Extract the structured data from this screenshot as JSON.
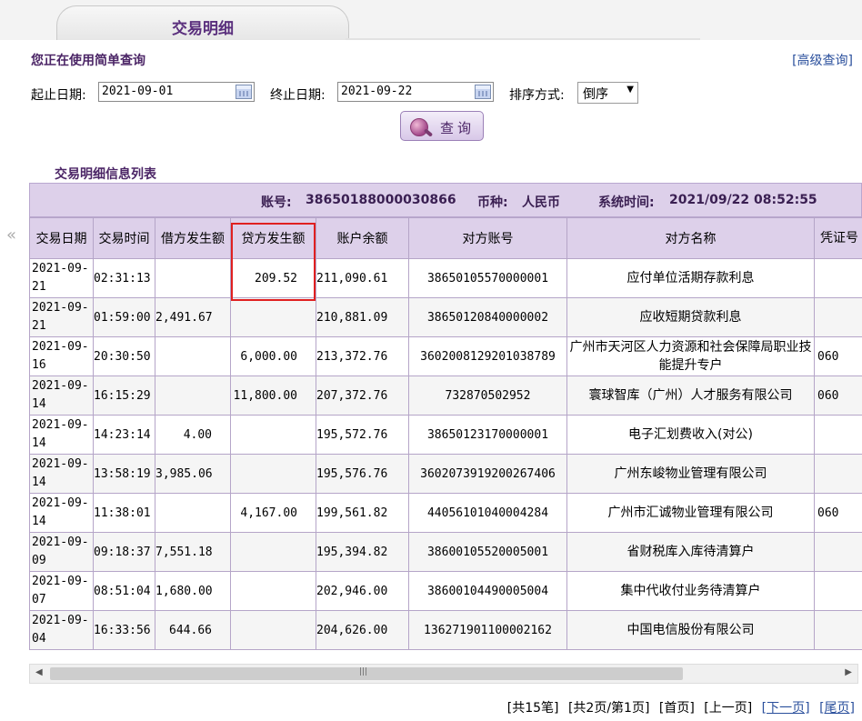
{
  "tab": {
    "title": "交易明细"
  },
  "query": {
    "title": "您正在使用简单查询",
    "advanced_link": "[高级查询]",
    "start_label": "起止日期:",
    "start_value": "2021-09-01",
    "end_label": "终止日期:",
    "end_value": "2021-09-22",
    "sort_label": "排序方式:",
    "sort_value": "倒序",
    "button_label": "查询"
  },
  "list": {
    "title": "交易明细信息列表",
    "account_label": "账号:",
    "account_value": "38650188000030866",
    "currency_label": "币种:",
    "currency_value": "人民币",
    "systime_label": "系统时间:",
    "systime_value": "2021/09/22 08:52:55"
  },
  "table": {
    "headers": [
      "交易日期",
      "交易时间",
      "借方发生额",
      "贷方发生额",
      "账户余额",
      "对方账号",
      "对方名称",
      "凭证号"
    ],
    "rows": [
      {
        "date": "2021-09-21",
        "time": "02:31:13",
        "debit": "",
        "credit": "209.52",
        "balance": "211,090.61",
        "acct": "38650105570000001",
        "name": "应付单位活期存款利息",
        "voucher": ""
      },
      {
        "date": "2021-09-21",
        "time": "01:59:00",
        "debit": "2,491.67",
        "credit": "",
        "balance": "210,881.09",
        "acct": "38650120840000002",
        "name": "应收短期贷款利息",
        "voucher": ""
      },
      {
        "date": "2021-09-16",
        "time": "20:30:50",
        "debit": "",
        "credit": "6,000.00",
        "balance": "213,372.76",
        "acct": "3602008129201038789",
        "name": "广州市天河区人力资源和社会保障局职业技能提升专户",
        "voucher": "060"
      },
      {
        "date": "2021-09-14",
        "time": "16:15:29",
        "debit": "",
        "credit": "11,800.00",
        "balance": "207,372.76",
        "acct": "732870502952",
        "name": "寰球智库（广州）人才服务有限公司",
        "voucher": "060"
      },
      {
        "date": "2021-09-14",
        "time": "14:23:14",
        "debit": "4.00",
        "credit": "",
        "balance": "195,572.76",
        "acct": "38650123170000001",
        "name": "电子汇划费收入(对公)",
        "voucher": ""
      },
      {
        "date": "2021-09-14",
        "time": "13:58:19",
        "debit": "3,985.06",
        "credit": "",
        "balance": "195,576.76",
        "acct": "3602073919200267406",
        "name": "广州东峻物业管理有限公司",
        "voucher": ""
      },
      {
        "date": "2021-09-14",
        "time": "11:38:01",
        "debit": "",
        "credit": "4,167.00",
        "balance": "199,561.82",
        "acct": "44056101040004284",
        "name": "广州市汇诚物业管理有限公司",
        "voucher": "060"
      },
      {
        "date": "2021-09-09",
        "time": "09:18:37",
        "debit": "7,551.18",
        "credit": "",
        "balance": "195,394.82",
        "acct": "38600105520005001",
        "name": "省财税库入库待清算户",
        "voucher": ""
      },
      {
        "date": "2021-09-07",
        "time": "08:51:04",
        "debit": "1,680.00",
        "credit": "",
        "balance": "202,946.00",
        "acct": "38600104490005004",
        "name": "集中代收付业务待清算户",
        "voucher": ""
      },
      {
        "date": "2021-09-04",
        "time": "16:33:56",
        "debit": "644.66",
        "credit": "",
        "balance": "204,626.00",
        "acct": "136271901100002162",
        "name": "中国电信股份有限公司",
        "voucher": ""
      }
    ]
  },
  "pager": {
    "total_records": "[共15笔]",
    "page_info": "[共2页/第1页]",
    "first": "[首页]",
    "prev": "[上一页]",
    "next": "[下一页]",
    "last": "[尾页]"
  },
  "icons": {
    "calendar": "calendar-icon",
    "search": "globe-search-icon",
    "collapse": "double-chevron-left-icon"
  },
  "colors": {
    "accent": "#5a2f7d",
    "header_bg": "#ddd0ea",
    "link": "#2a4f9c",
    "highlight": "#e02020"
  }
}
